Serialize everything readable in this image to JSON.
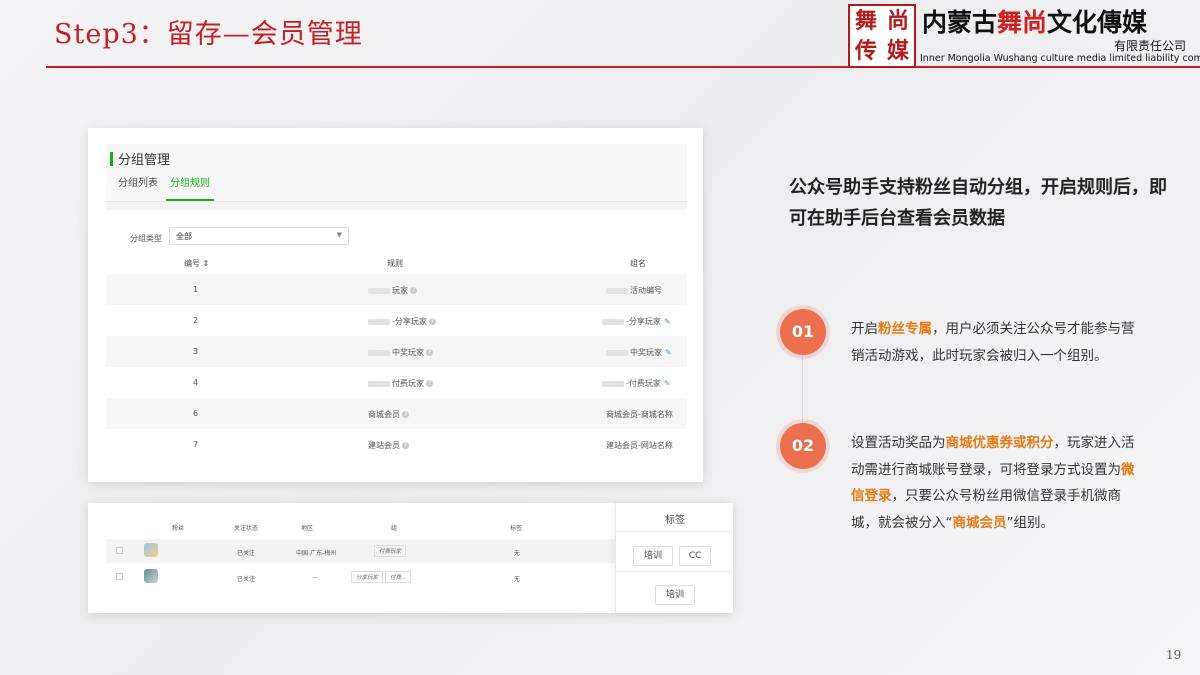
{
  "slide": {
    "title": "Step3：留存—会员管理",
    "page_number": "19"
  },
  "logo": {
    "seal_chars": [
      "舞",
      "尚",
      "传",
      "媒"
    ],
    "name_part1": "内蒙古",
    "name_part2": "舞尚",
    "name_part3": "文化傳媒",
    "sub": "有限责任公司",
    "english": "Inner Mongolia Wushang culture media limited liability company"
  },
  "group_panel": {
    "title": "分组管理",
    "tabs": [
      {
        "label": "分组列表",
        "active": false
      },
      {
        "label": "分组规则",
        "active": true
      }
    ],
    "filter_label": "分组类型",
    "filter_value": "全部",
    "columns": [
      "编号",
      "规则",
      "组名"
    ],
    "rows": [
      {
        "id": "1",
        "rule": "玩家",
        "group": "活动编号",
        "editable": false
      },
      {
        "id": "2",
        "rule": "-分享玩家",
        "group": "-分享玩家",
        "editable": true
      },
      {
        "id": "3",
        "rule": "中奖玩家",
        "group": "中奖玩家",
        "editable": true
      },
      {
        "id": "4",
        "rule": "付费玩家",
        "group": "-付费玩家",
        "editable": true
      },
      {
        "id": "6",
        "rule": "商城会员",
        "group": "商城会员-商城名称",
        "editable": false
      },
      {
        "id": "7",
        "rule": "建站会员",
        "group": "建站会员-网站名称",
        "editable": false
      }
    ]
  },
  "fans_panel": {
    "columns": [
      "粉丝",
      "关注状态",
      "地区",
      "组",
      "标签"
    ],
    "rows": [
      {
        "status": "已关注",
        "region": "中国-广东-梅州",
        "groups": [
          "付费玩家"
        ],
        "tag": "无"
      },
      {
        "status": "已关注",
        "region": "--",
        "groups": [
          "分享玩家",
          "付费..."
        ],
        "tag": "无"
      }
    ],
    "tag_popup": {
      "title": "标签",
      "tags": [
        "培训",
        "CC"
      ],
      "selected": "培训"
    }
  },
  "content": {
    "headline": "公众号助手支持粉丝自动分组，开启规则后，即可在助手后台查看会员数据",
    "steps": [
      {
        "num": "01",
        "pre": "开启",
        "hl1": "粉丝专属",
        "post": "，用户必须关注公众号才能参与营销活动游戏，此时玩家会被归入一个组别。"
      },
      {
        "num": "02",
        "pre": "设置活动奖品为",
        "hl1": "商城优惠券或积分",
        "mid1": "，玩家进入活动需进行商城账号登录，可将登录方式设置为",
        "hl2": "微信登录",
        "mid2": "，只要公众号粉丝用微信登录手机微商城，就会被分入“",
        "hl3": "商城会员",
        "post": "”组别。"
      }
    ]
  },
  "colors": {
    "brand_red": "#c41e24",
    "accent_green": "#1aad19",
    "step_orange": "#ec6f50",
    "highlight_orange": "#e87a14"
  }
}
